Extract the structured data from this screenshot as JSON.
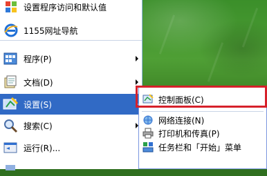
{
  "pinned": {
    "top_item_label": "设置程序访问和默认值",
    "browser_label": "1155网址导航"
  },
  "menu": {
    "items": [
      {
        "label": "程序(P)",
        "icon": "programs-icon",
        "has_submenu": true
      },
      {
        "label": "文档(D)",
        "icon": "documents-icon",
        "has_submenu": true
      },
      {
        "label": "设置(S)",
        "icon": "settings-icon",
        "has_submenu": true,
        "selected": true
      },
      {
        "label": "搜索(C)",
        "icon": "search-icon",
        "has_submenu": true
      },
      {
        "label": "运行(R)...",
        "icon": "run-icon",
        "has_submenu": false
      }
    ]
  },
  "submenu": {
    "items": [
      {
        "label": "控制面板(C)",
        "icon": "control-panel-icon",
        "highlighted_by_annotation": true
      },
      {
        "label": "网络连接(N)",
        "icon": "network-connections-icon"
      },
      {
        "label": "打印机和传真(P)",
        "icon": "printer-icon"
      },
      {
        "label": "任务栏和「开始」菜单",
        "icon": "taskbar-icon"
      }
    ]
  },
  "colors": {
    "selection": "#316ac5",
    "annotation_box": "#d6202a",
    "wallpaper": "#3b8f2a"
  }
}
